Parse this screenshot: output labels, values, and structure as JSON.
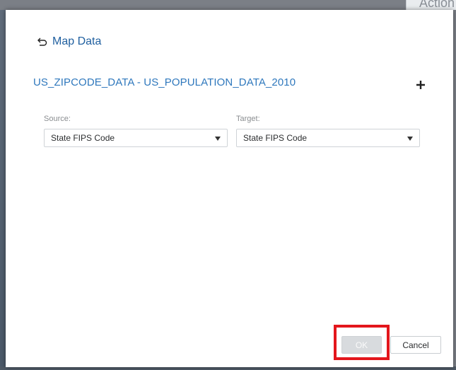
{
  "background": {
    "partial_text": "Action"
  },
  "dialog": {
    "header": {
      "back_label": "Map Data"
    },
    "pair_title": "US_ZIPCODE_DATA - US_POPULATION_DATA_2010",
    "source": {
      "label": "Source:",
      "value": "State FIPS Code"
    },
    "target": {
      "label": "Target:",
      "value": "State FIPS Code"
    },
    "buttons": {
      "ok": "OK",
      "cancel": "Cancel"
    }
  },
  "colors": {
    "link": "#1f5f9f",
    "title": "#2f78bd",
    "highlight": "#e3161c"
  },
  "icons": {
    "back": "undo-arrow-icon",
    "add": "plus-icon",
    "dropdown": "caret-down-icon"
  }
}
